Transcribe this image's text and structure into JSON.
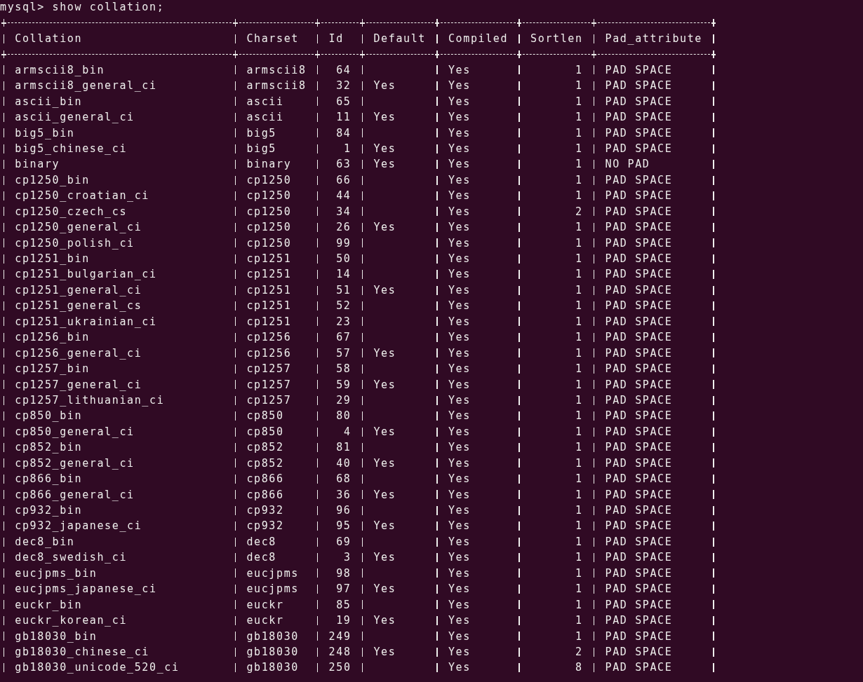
{
  "command_line": "mysql> show collation;",
  "table": {
    "columns": [
      {
        "label": "Collation"
      },
      {
        "label": "Charset"
      },
      {
        "label": "Id"
      },
      {
        "label": "Default"
      },
      {
        "label": "Compiled"
      },
      {
        "label": "Sortlen"
      },
      {
        "label": "Pad_attribute"
      }
    ],
    "rows": [
      {
        "collation": "armscii8_bin",
        "charset": "armscii8",
        "id": "64",
        "compiled": "Yes",
        "sortlen": "1",
        "pad_attribute": "PAD SPACE"
      },
      {
        "collation": "armscii8_general_ci",
        "charset": "armscii8",
        "id": "32",
        "default": "Yes",
        "compiled": "Yes",
        "sortlen": "1",
        "pad_attribute": "PAD SPACE"
      },
      {
        "collation": "ascii_bin",
        "charset": "ascii",
        "id": "65",
        "compiled": "Yes",
        "sortlen": "1",
        "pad_attribute": "PAD SPACE"
      },
      {
        "collation": "ascii_general_ci",
        "charset": "ascii",
        "id": "11",
        "default": "Yes",
        "compiled": "Yes",
        "sortlen": "1",
        "pad_attribute": "PAD SPACE"
      },
      {
        "collation": "big5_bin",
        "charset": "big5",
        "id": "84",
        "compiled": "Yes",
        "sortlen": "1",
        "pad_attribute": "PAD SPACE"
      },
      {
        "collation": "big5_chinese_ci",
        "charset": "big5",
        "id": "1",
        "default": "Yes",
        "compiled": "Yes",
        "sortlen": "1",
        "pad_attribute": "PAD SPACE"
      },
      {
        "collation": "binary",
        "charset": "binary",
        "id": "63",
        "default": "Yes",
        "compiled": "Yes",
        "sortlen": "1",
        "pad_attribute": "NO PAD"
      },
      {
        "collation": "cp1250_bin",
        "charset": "cp1250",
        "id": "66",
        "compiled": "Yes",
        "sortlen": "1",
        "pad_attribute": "PAD SPACE"
      },
      {
        "collation": "cp1250_croatian_ci",
        "charset": "cp1250",
        "id": "44",
        "compiled": "Yes",
        "sortlen": "1",
        "pad_attribute": "PAD SPACE"
      },
      {
        "collation": "cp1250_czech_cs",
        "charset": "cp1250",
        "id": "34",
        "compiled": "Yes",
        "sortlen": "2",
        "pad_attribute": "PAD SPACE"
      },
      {
        "collation": "cp1250_general_ci",
        "charset": "cp1250",
        "id": "26",
        "default": "Yes",
        "compiled": "Yes",
        "sortlen": "1",
        "pad_attribute": "PAD SPACE"
      },
      {
        "collation": "cp1250_polish_ci",
        "charset": "cp1250",
        "id": "99",
        "compiled": "Yes",
        "sortlen": "1",
        "pad_attribute": "PAD SPACE"
      },
      {
        "collation": "cp1251_bin",
        "charset": "cp1251",
        "id": "50",
        "compiled": "Yes",
        "sortlen": "1",
        "pad_attribute": "PAD SPACE"
      },
      {
        "collation": "cp1251_bulgarian_ci",
        "charset": "cp1251",
        "id": "14",
        "compiled": "Yes",
        "sortlen": "1",
        "pad_attribute": "PAD SPACE"
      },
      {
        "collation": "cp1251_general_ci",
        "charset": "cp1251",
        "id": "51",
        "default": "Yes",
        "compiled": "Yes",
        "sortlen": "1",
        "pad_attribute": "PAD SPACE"
      },
      {
        "collation": "cp1251_general_cs",
        "charset": "cp1251",
        "id": "52",
        "compiled": "Yes",
        "sortlen": "1",
        "pad_attribute": "PAD SPACE"
      },
      {
        "collation": "cp1251_ukrainian_ci",
        "charset": "cp1251",
        "id": "23",
        "compiled": "Yes",
        "sortlen": "1",
        "pad_attribute": "PAD SPACE"
      },
      {
        "collation": "cp1256_bin",
        "charset": "cp1256",
        "id": "67",
        "compiled": "Yes",
        "sortlen": "1",
        "pad_attribute": "PAD SPACE"
      },
      {
        "collation": "cp1256_general_ci",
        "charset": "cp1256",
        "id": "57",
        "default": "Yes",
        "compiled": "Yes",
        "sortlen": "1",
        "pad_attribute": "PAD SPACE"
      },
      {
        "collation": "cp1257_bin",
        "charset": "cp1257",
        "id": "58",
        "compiled": "Yes",
        "sortlen": "1",
        "pad_attribute": "PAD SPACE"
      },
      {
        "collation": "cp1257_general_ci",
        "charset": "cp1257",
        "id": "59",
        "default": "Yes",
        "compiled": "Yes",
        "sortlen": "1",
        "pad_attribute": "PAD SPACE"
      },
      {
        "collation": "cp1257_lithuanian_ci",
        "charset": "cp1257",
        "id": "29",
        "compiled": "Yes",
        "sortlen": "1",
        "pad_attribute": "PAD SPACE"
      },
      {
        "collation": "cp850_bin",
        "charset": "cp850",
        "id": "80",
        "compiled": "Yes",
        "sortlen": "1",
        "pad_attribute": "PAD SPACE"
      },
      {
        "collation": "cp850_general_ci",
        "charset": "cp850",
        "id": "4",
        "default": "Yes",
        "compiled": "Yes",
        "sortlen": "1",
        "pad_attribute": "PAD SPACE"
      },
      {
        "collation": "cp852_bin",
        "charset": "cp852",
        "id": "81",
        "compiled": "Yes",
        "sortlen": "1",
        "pad_attribute": "PAD SPACE"
      },
      {
        "collation": "cp852_general_ci",
        "charset": "cp852",
        "id": "40",
        "default": "Yes",
        "compiled": "Yes",
        "sortlen": "1",
        "pad_attribute": "PAD SPACE"
      },
      {
        "collation": "cp866_bin",
        "charset": "cp866",
        "id": "68",
        "compiled": "Yes",
        "sortlen": "1",
        "pad_attribute": "PAD SPACE"
      },
      {
        "collation": "cp866_general_ci",
        "charset": "cp866",
        "id": "36",
        "default": "Yes",
        "compiled": "Yes",
        "sortlen": "1",
        "pad_attribute": "PAD SPACE"
      },
      {
        "collation": "cp932_bin",
        "charset": "cp932",
        "id": "96",
        "compiled": "Yes",
        "sortlen": "1",
        "pad_attribute": "PAD SPACE"
      },
      {
        "collation": "cp932_japanese_ci",
        "charset": "cp932",
        "id": "95",
        "default": "Yes",
        "compiled": "Yes",
        "sortlen": "1",
        "pad_attribute": "PAD SPACE"
      },
      {
        "collation": "dec8_bin",
        "charset": "dec8",
        "id": "69",
        "compiled": "Yes",
        "sortlen": "1",
        "pad_attribute": "PAD SPACE"
      },
      {
        "collation": "dec8_swedish_ci",
        "charset": "dec8",
        "id": "3",
        "default": "Yes",
        "compiled": "Yes",
        "sortlen": "1",
        "pad_attribute": "PAD SPACE"
      },
      {
        "collation": "eucjpms_bin",
        "charset": "eucjpms",
        "id": "98",
        "compiled": "Yes",
        "sortlen": "1",
        "pad_attribute": "PAD SPACE"
      },
      {
        "collation": "eucjpms_japanese_ci",
        "charset": "eucjpms",
        "id": "97",
        "default": "Yes",
        "compiled": "Yes",
        "sortlen": "1",
        "pad_attribute": "PAD SPACE"
      },
      {
        "collation": "euckr_bin",
        "charset": "euckr",
        "id": "85",
        "compiled": "Yes",
        "sortlen": "1",
        "pad_attribute": "PAD SPACE"
      },
      {
        "collation": "euckr_korean_ci",
        "charset": "euckr",
        "id": "19",
        "default": "Yes",
        "compiled": "Yes",
        "sortlen": "1",
        "pad_attribute": "PAD SPACE"
      },
      {
        "collation": "gb18030_bin",
        "charset": "gb18030",
        "id": "249",
        "compiled": "Yes",
        "sortlen": "1",
        "pad_attribute": "PAD SPACE"
      },
      {
        "collation": "gb18030_chinese_ci",
        "charset": "gb18030",
        "id": "248",
        "default": "Yes",
        "compiled": "Yes",
        "sortlen": "2",
        "pad_attribute": "PAD SPACE"
      },
      {
        "collation": "gb18030_unicode_520_ci",
        "charset": "gb18030",
        "id": "250",
        "compiled": "Yes",
        "sortlen": "8",
        "pad_attribute": "PAD SPACE"
      }
    ]
  }
}
